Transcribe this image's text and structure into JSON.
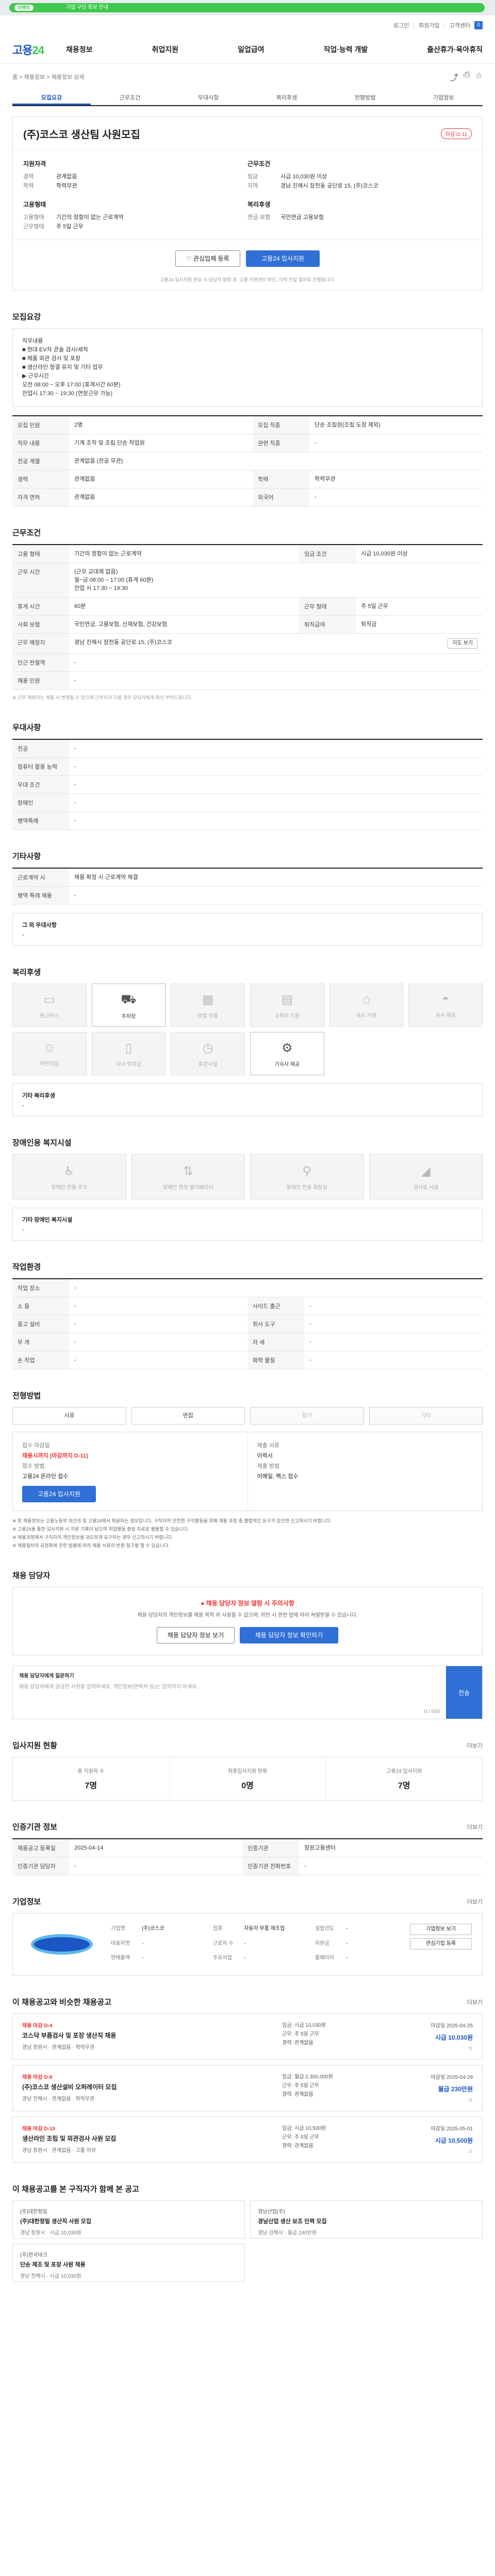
{
  "banner": {
    "badge": "이벤트",
    "text": "기업 구인 정보 안내"
  },
  "util": {
    "login": "로그인",
    "join": "회원가입",
    "center": "고객센터",
    "count": "0"
  },
  "gnb": {
    "logo_main": "고용",
    "logo_sub": "24",
    "menu": [
      "채용정보",
      "취업지원",
      "일업급여",
      "직업·능력 개발",
      "출산휴가·육아휴직"
    ]
  },
  "page": {
    "breadcrumb": "홈 > 채용정보 > 채용정보 상세",
    "tabs": [
      "모집요강",
      "근무조건",
      "우대사항",
      "복리후생",
      "전형방법",
      "기업정보"
    ]
  },
  "head": {
    "company": "(주)코스코 생산팀 사원모집",
    "dday": "마감 D-11",
    "recruit_title": "지원자격",
    "recruit": [
      {
        "k": "경력",
        "v": "관계없음"
      },
      {
        "k": "학력",
        "v": "학력무관"
      }
    ],
    "work_title": "근무조건",
    "work": [
      {
        "k": "임금",
        "v": "시급 10,030원 이상"
      },
      {
        "k": "지역",
        "v": "경남 진해시 장천동 공단로 15, (주)코스코"
      }
    ],
    "type_title": "고용형태",
    "type": [
      {
        "k": "고용형태",
        "v": "기간의 정함이 없는 근로계약"
      },
      {
        "k": "근무형태",
        "v": "주 5일 근무"
      }
    ],
    "time_title": "복리후생",
    "time": [
      {
        "k": "연금·보험",
        "v": "국민연금 고용보험"
      }
    ],
    "btn_save": "관심업체 등록",
    "btn_apply": "고용24 입사지원",
    "notice": "고용24 입사지원 완료 시 담당자 알림 후, 고용 지원센터 확인, 이력 전달 절차로 진행됩니다."
  },
  "recruit": {
    "title": "모집요강",
    "desc": "직무내용\n■ 현대 EV차 콘솔 검사/세척\n■ 제품 외관 검사 및 포장\n■ 생산라인 청결 유지 및 기타 업무\n▶ 근무시간\n  오전 08:00 ~ 오후 17:00 (휴게시간 60분)\n  잔업시 17:30 ~ 19:30 (연장근무 가능)",
    "rows": [
      {
        "k1": "모집 인원",
        "v1": "2명",
        "k2": "모집 직종",
        "v2": "단순 조립원(조립 도장 제외)"
      },
      {
        "k1": "직무 내용",
        "v1": "기계 조작 및 조립 단순 작업원",
        "k2": "관련 직종",
        "v2": "-"
      },
      {
        "k1": "전공 계열",
        "v1": "관계없음 (전공 무관)",
        "k2": "",
        "v2": ""
      },
      {
        "k1": "경력",
        "v1": "관계없음",
        "k2": "학력",
        "v2": "학력무관"
      },
      {
        "k1": "자격 면허",
        "v1": "관계없음",
        "k2": "외국어",
        "v2": "-"
      }
    ]
  },
  "work": {
    "title": "근무조건",
    "rows": [
      {
        "k1": "고용 형태",
        "v1": "기간의 정함이 없는 근로계약",
        "k2": "임금 조건",
        "v2": "시급 10,030원 이상"
      },
      {
        "k1": "근무 시간",
        "v1": "(근무 교대제 없음)\n월~금 08:00 ~ 17:00 (휴게 60분)\n잔업 시 17:30 ~ 19:30",
        "k2": "",
        "v2": ""
      },
      {
        "k1": "휴게 시간",
        "v1": "60분",
        "k2": "근무 형태",
        "v2": "주 5일 근무"
      },
      {
        "k1": "사회 보험",
        "v1": "국민연금, 고용보험, 산재보험, 건강보험",
        "k2": "퇴직급여",
        "v2": "퇴직금"
      },
      {
        "k1": "근무 예정지",
        "v1": "경남 진해시 장천동 공단로 15, (주)코스코",
        "k2": "",
        "v2": ""
      },
      {
        "k1": "인근 전철역",
        "v1": "-",
        "k2": "",
        "v2": ""
      },
      {
        "k1": "채용 인원",
        "v1": "-",
        "k2": "",
        "v2": ""
      }
    ],
    "map_btn": "지도 보기",
    "note": "※ 근무 예정지는 채용 시 변경될 수 있으며 근무지가 다를 경우 담당자에게 확인 부탁드립니다."
  },
  "pref": {
    "title": "우대사항",
    "rows": [
      {
        "k": "전공",
        "v": "-"
      },
      {
        "k": "컴퓨터 활용 능력",
        "v": "-"
      },
      {
        "k": "우대 조건",
        "v": "-"
      },
      {
        "k": "장애인",
        "v": "-"
      },
      {
        "k": "병역특례",
        "v": "-"
      }
    ]
  },
  "etc": {
    "title": "기타사항",
    "rows": [
      {
        "k": "근로계약 시",
        "v": "채용 확정 시 근로계약 체결"
      },
      {
        "k": "병역 특례 채용",
        "v": "-"
      }
    ],
    "box_title": "그 외 우대사항",
    "box_val": "-"
  },
  "welfare": {
    "title": "복리후생",
    "items": [
      {
        "icon": "bed-icon",
        "label": "통근버스",
        "on": false
      },
      {
        "icon": "car-icon",
        "label": "주차장",
        "on": true
      },
      {
        "icon": "calendar-icon",
        "label": "명절 선물",
        "on": false
      },
      {
        "icon": "laptop-icon",
        "label": "교육비 지원",
        "on": false
      },
      {
        "icon": "house-icon",
        "label": "숙소 지원",
        "on": false
      },
      {
        "icon": "meal-icon",
        "label": "식사 제공",
        "on": false
      },
      {
        "icon": "child-icon",
        "label": "어린이집",
        "on": false
      },
      {
        "icon": "doc-icon",
        "label": "자녀 학자금",
        "on": false
      },
      {
        "icon": "clock-icon",
        "label": "휴양시설",
        "on": false
      },
      {
        "icon": "gear-icon",
        "label": "기숙사 제공",
        "on": true
      }
    ],
    "box_title": "기타 복리후생",
    "box_val": "-"
  },
  "disability": {
    "title": "장애인용 복지시설",
    "items": [
      {
        "icon": "wheelchair-icon",
        "label": "장애인 전용 주차"
      },
      {
        "icon": "elevator-icon",
        "label": "장애인 편의 엘리베이터"
      },
      {
        "icon": "toilet-icon",
        "label": "장애인 전용 화장실"
      },
      {
        "icon": "ramp-icon",
        "label": "경사로 시설"
      }
    ],
    "box_title": "기타 장애인 복지시설",
    "box_val": "-"
  },
  "workenv": {
    "title": "작업환경",
    "rows": [
      {
        "k1": "작업 장소",
        "v1": "-",
        "k2": "",
        "v2": ""
      },
      {
        "k1": "소 음",
        "v1": "-",
        "k2": "사이드 출근",
        "v2": "-"
      },
      {
        "k1": "중고 설비",
        "v1": "-",
        "k2": "취사 도구",
        "v2": "-"
      },
      {
        "k1": "무 게",
        "v1": "-",
        "k2": "자 세",
        "v2": "-"
      },
      {
        "k1": "손 작업",
        "v1": "-",
        "k2": "화학 물질",
        "v2": "-"
      }
    ]
  },
  "method": {
    "title": "전형방법",
    "tabs": [
      {
        "label": "서류",
        "off": false
      },
      {
        "label": "면접",
        "off": false
      },
      {
        "label": "필기",
        "off": true
      },
      {
        "label": "기타",
        "off": true
      }
    ],
    "left": [
      {
        "k": "접수 마감일",
        "v": "채용시까지 (마감까지 D-11)",
        "red": true
      },
      {
        "k": "접수 방법",
        "v": "고용24 온라인 접수",
        "red": false
      }
    ],
    "right": [
      {
        "k": "제출 서류",
        "v": "이력서"
      },
      {
        "k": "제출 방법",
        "v": "이메일, 팩스 접수"
      }
    ],
    "btn": "고용24 입사지원",
    "bullets": [
      "※ 본 채용정보는 고용노동부 워크넷 및 고용24에서 제공하는 정보입니다. 구직자의 안전한 구직활동을 위해 채용 과정 중 불법적인 요구가 있으면 신고하시기 바랍니다.",
      "※ 고용24를 통한 입사지원 시 지원 기록이 남으며 취업활동 증빙 자료로 활용할 수 있습니다.",
      "※ 채용과정에서 구직자의 개인정보를 과도하게 요구하는 경우 신고하시기 바랍니다.",
      "※ 채용절차의 공정화에 관한 법률에 따라 채용 서류의 반환 청구를 할 수 있습니다."
    ]
  },
  "contact": {
    "title": "채용 담당자",
    "t1": "● 채용 담당자 정보 열람 시 주의사항",
    "t2": "채용 담당자의 개인정보를 채용 목적 외 사용할 수 없으며, 위반 시 관련 법에 따라 처벌받을 수 있습니다.",
    "btn1": "채용 담당자 정보 보기",
    "btn2": "채용 담당자 정보 확인하기",
    "qa_title": "채용 담당자에게 질문하기",
    "qa_placeholder": "채용 담당자에게 궁금한 사항을 입력하세요. 개인정보(연락처 등)는 입력하지 마세요.",
    "qa_count": "0 / 500",
    "qa_send": "전송"
  },
  "stats": {
    "title": "입사지원 현황",
    "more": "더보기",
    "items": [
      {
        "label": "총 지원자 수",
        "value": "7명"
      },
      {
        "label": "최종입사지원 현황",
        "value": "0명"
      },
      {
        "label": "고용24 입사지원",
        "value": "7명"
      }
    ]
  },
  "admin": {
    "title": "인증기관 정보",
    "more": "더보기",
    "rows": [
      {
        "k1": "채용공고 등록일",
        "v1": "2025-04-14",
        "k2": "인증기관",
        "v2": "창원고용센터"
      },
      {
        "k1": "인증기관 담당자",
        "v1": "-",
        "k2": "인증기관 전화번호",
        "v2": "-"
      }
    ]
  },
  "company": {
    "title": "기업정보",
    "more": "더보기",
    "info": [
      {
        "k": "기업명",
        "v": "(주)코스코"
      },
      {
        "k": "업종",
        "v": "자동차 부품 제조업"
      },
      {
        "k": "설립년도",
        "v": "-"
      },
      {
        "k": "대표자명",
        "v": "-"
      },
      {
        "k": "근로자 수",
        "v": "-"
      },
      {
        "k": "자본금",
        "v": "-"
      },
      {
        "k": "연매출액",
        "v": "-"
      },
      {
        "k": "주요사업",
        "v": "-"
      },
      {
        "k": "홈페이지",
        "v": "-"
      }
    ],
    "btn1": "기업정보 보기",
    "btn2": "관심기업 등록"
  },
  "similar": {
    "title": "이 채용공고와 비슷한 채용공고",
    "more": "더보기",
    "jobs": [
      {
        "co": "채용 마감 D-4",
        "title": "코스닥 부품검사 및 포장 생산직 채용",
        "meta": "경남 창원시 · 관계없음 · 학력무관",
        "mid": "임금: 시급 10,030원\n근무: 주 5일 근무\n경력: 관계없음",
        "right": "마감일 2025-04-25",
        "pay": "시급 10,030원"
      },
      {
        "co": "채용 마감 D-8",
        "title": "(주)코스코 생산설비 오퍼레이터 모집",
        "meta": "경남 진해시 · 관계없음 · 학력무관",
        "mid": "임금: 월급 2,300,000원\n근무: 주 5일 근무\n경력: 관계없음",
        "right": "마감일 2025-04-29",
        "pay": "월급 230만원"
      },
      {
        "co": "채용 마감 D-10",
        "title": "생산라인 조립 및 외관검사 사원 모집",
        "meta": "경남 창원시 · 관계없음 · 고졸 이상",
        "mid": "임금: 시급 10,500원\n근무: 주 5일 근무\n경력: 관계없음",
        "right": "마감일 2025-05-01",
        "pay": "시급 10,500원"
      }
    ]
  },
  "picks": {
    "title": "이 채용공고를 본 구직자가 함께 본 공고",
    "items": [
      {
        "co": "(주)대한정밀",
        "title": "(주)대한정밀 생산직 사원 모집",
        "meta": "경남 창원시 · 시급 10,030원"
      },
      {
        "co": "경남산업(주)",
        "title": "경남산업 생산 보조 인력 모집",
        "meta": "경남 김해시 · 월급 240만원"
      },
      {
        "co": "(주)한국테크",
        "title": "단순 제조 및 포장 사원 채용",
        "meta": "경남 진해시 · 시급 10,030원"
      }
    ]
  }
}
